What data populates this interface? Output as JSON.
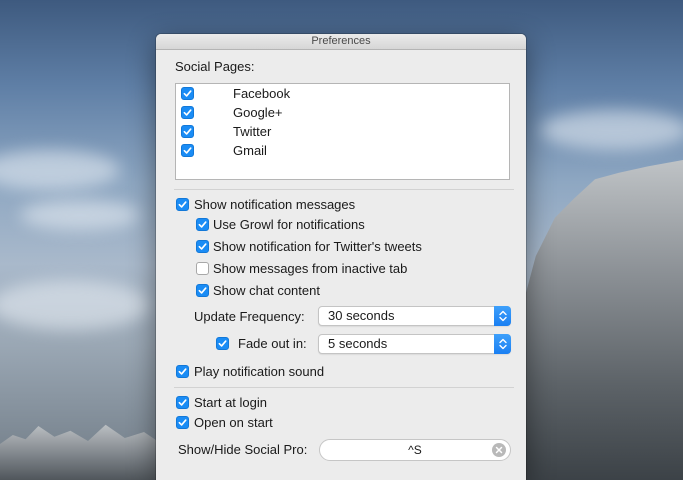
{
  "window": {
    "title": "Preferences"
  },
  "social_pages": {
    "heading": "Social Pages:",
    "items": [
      {
        "label": "Facebook",
        "checked": true
      },
      {
        "label": "Google+",
        "checked": true
      },
      {
        "label": "Twitter",
        "checked": true
      },
      {
        "label": "Gmail",
        "checked": true
      }
    ]
  },
  "notifications": {
    "show_messages": {
      "label": "Show notification messages",
      "checked": true
    },
    "use_growl": {
      "label": "Use Growl for notifications",
      "checked": true
    },
    "twitter_tweets": {
      "label": "Show notification for Twitter's tweets",
      "checked": true
    },
    "inactive_tab": {
      "label": "Show messages from inactive tab",
      "checked": false
    },
    "chat_content": {
      "label": "Show chat content",
      "checked": true
    },
    "update_frequency": {
      "label": "Update Frequency:",
      "value": "30 seconds"
    },
    "fade_out": {
      "label": "Fade out in:",
      "value": "5 seconds",
      "checked": true
    },
    "play_sound": {
      "label": "Play notification sound",
      "checked": true
    }
  },
  "startup": {
    "start_at_login": {
      "label": "Start at login",
      "checked": true
    },
    "open_on_start": {
      "label": "Open on start",
      "checked": true
    }
  },
  "shortcut": {
    "label": "Show/Hide Social Pro:",
    "value": "^S"
  },
  "colors": {
    "accent": "#1a8cf5",
    "window_bg": "#ececec"
  }
}
